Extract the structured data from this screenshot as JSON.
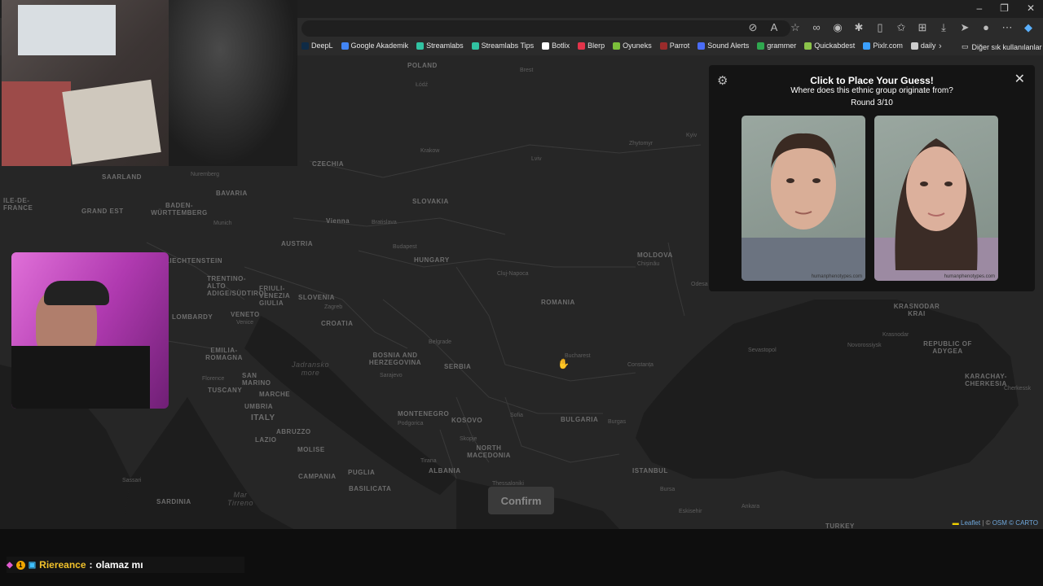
{
  "window": {
    "minimize": "–",
    "maximize": "❐",
    "close": "✕"
  },
  "toolbar_icons": [
    "eye-off-icon",
    "read-aloud-icon",
    "star-icon",
    "extension-icon",
    "audio-icon",
    "puzzle-icon",
    "split-icon",
    "favorites-icon",
    "collections-icon",
    "download-icon",
    "share-icon",
    "profile-icon",
    "more-icon",
    "copilot-icon"
  ],
  "bookmarks": [
    {
      "label": "DeepL",
      "color": "#0f2b46"
    },
    {
      "label": "Google Akademik",
      "color": "#4285f4"
    },
    {
      "label": "Streamlabs",
      "color": "#31c3a2"
    },
    {
      "label": "Streamlabs Tips",
      "color": "#31c3a2"
    },
    {
      "label": "Botlix",
      "color": "#ffffff"
    },
    {
      "label": "Blerp",
      "color": "#e3344a"
    },
    {
      "label": "Oyuneks",
      "color": "#7bbf3a"
    },
    {
      "label": "Parrot",
      "color": "#9a2b2b"
    },
    {
      "label": "Sound Alerts",
      "color": "#4a6cf7"
    },
    {
      "label": "grammer",
      "color": "#2fa84f"
    },
    {
      "label": "Quickabdest",
      "color": "#8bc34a"
    },
    {
      "label": "Pixlr.com",
      "color": "#3ba0ff"
    },
    {
      "label": "daily",
      "color": "#cccccc"
    }
  ],
  "bookmarks_more": "›",
  "bookmarks_other": "Diğer sık kullanılanlar",
  "panel": {
    "title": "Click to Place Your Guess!",
    "question": "Where does this ethnic group originate from?",
    "round": "Round 3/10",
    "face_source_1": "humanphenotypes.com",
    "face_source_2": "humanphenotypes.com"
  },
  "confirm_label": "Confirm",
  "attribution": {
    "leaflet": "Leaflet",
    "sep": " | © ",
    "osm": "OSM",
    "carto": "© CARTO"
  },
  "map_labels": {
    "countries": [
      "POLAND",
      "CZECHIA",
      "SLOVAKIA",
      "AUSTRIA",
      "HUNGARY",
      "SLOVENIA",
      "CROATIA",
      "BOSNIA AND HERZEGOVINA",
      "SERBIA",
      "ROMANIA",
      "MOLDOVA",
      "BULGARIA",
      "KOSOVO",
      "NORTH MACEDONIA",
      "ALBANIA",
      "MONTENEGRO",
      "ITALY",
      "SAN MARINO",
      "BAVARIA",
      "BADEN-WÜRTTEMBERG",
      "GRAND EST",
      "ILE-DE-FRANCE",
      "SAARLAND",
      "LOMBARDY",
      "VENETO",
      "EMILIA-ROMAGNA",
      "TUSCANY",
      "UMBRIA",
      "MARCHE",
      "LAZIO",
      "ABRUZZO",
      "MOLISE",
      "CAMPANIA",
      "PUGLIA",
      "BASILICATA",
      "SARDINIA",
      "FRIULI-VENEZIA GIULIA",
      "TRENTINO-ALTO ADIGE/SÜDTIROL",
      "KRASNODAR KRAI",
      "REPUBLIC OF ADYGEA",
      "KARACHAY-CHERKESIA",
      "ISTANBUL",
      "TURKEY",
      "LIECHTENSTEIN"
    ],
    "cities": [
      "Łódź",
      "Brest",
      "Krakow",
      "Lviv",
      "Zhytomyr",
      "Kyiv",
      "Nuremberg",
      "Munich",
      "Vienna",
      "Bratislava",
      "Budapest",
      "Cluj-Napoca",
      "Chișinău",
      "Odesa",
      "Zagreb",
      "Belgrade",
      "Sarajevo",
      "Bucharest",
      "Constanța",
      "Sofia",
      "Podgorica",
      "Skopje",
      "Tirana",
      "Thessaloniki",
      "Burgas",
      "Florence",
      "Venice",
      "Sassari",
      "Novorossiysk",
      "Krasnodar",
      "Sevastopol",
      "Ankara",
      "Eskisehir",
      "Bursa",
      "Cherkessk"
    ],
    "seas": [
      "Jadransko more",
      "Mar Tirreno"
    ]
  },
  "chat": {
    "name": "Riereance",
    "separator": " : ",
    "message": "olamaz mı"
  }
}
